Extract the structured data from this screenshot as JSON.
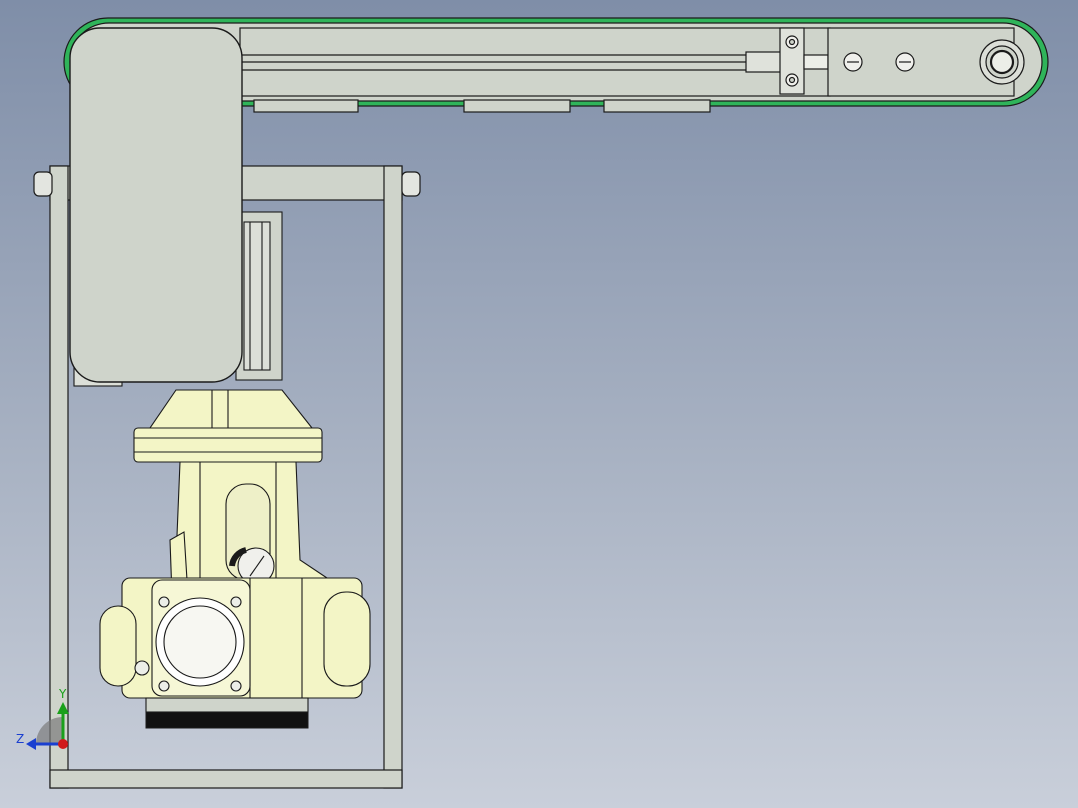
{
  "viewport": {
    "background_top": "#7f8ea8",
    "background_bottom": "#c9cfda"
  },
  "colors": {
    "belt_green": "#2fb45a",
    "panel_gray": "#cfd4cb",
    "motor_yellow": "#f3f5c6",
    "outline": "#1a1a1a",
    "rubber_black": "#111111"
  },
  "triad": {
    "y_label": "Y",
    "z_label": "Z",
    "y_color": "#1aa01a",
    "z_color": "#1a3fd0",
    "x_color": "#d01a1a"
  },
  "model": {
    "parts": [
      "belt-conveyor",
      "slide-rail",
      "frame",
      "gear-motor",
      "motor-housing",
      "terminal-box",
      "cable-gland"
    ]
  }
}
